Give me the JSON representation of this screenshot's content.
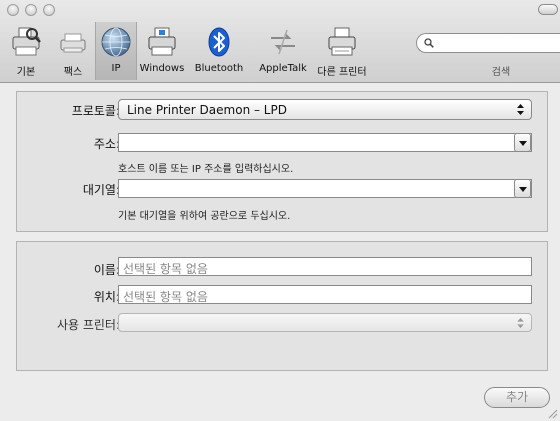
{
  "toolbar": {
    "items": [
      {
        "label": "기본",
        "icon": "default-printer-icon",
        "selected": false
      },
      {
        "label": "팩스",
        "icon": "fax-icon",
        "selected": false
      },
      {
        "label": "IP",
        "icon": "ip-globe-icon",
        "selected": true
      },
      {
        "label": "Windows",
        "icon": "windows-printer-icon",
        "selected": false
      },
      {
        "label": "Bluetooth",
        "icon": "bluetooth-icon",
        "selected": false
      },
      {
        "label": "AppleTalk",
        "icon": "appletalk-icon",
        "selected": false
      },
      {
        "label": "다른 프린터",
        "icon": "other-printer-icon",
        "selected": false
      }
    ],
    "search": {
      "label": "검색",
      "value": "",
      "icon": "magnifier-icon"
    }
  },
  "connection": {
    "protocol_label": "프로토콜:",
    "protocol_value": "Line Printer Daemon – LPD",
    "address_label": "주소:",
    "address_value": "",
    "address_hint": "호스트 이름 또는 IP 주소를 입력하십시오.",
    "queue_label": "대기열:",
    "queue_value": "",
    "queue_hint": "기본 대기열을 위하여 공란으로 두십시오."
  },
  "details": {
    "name_label": "이름:",
    "name_placeholder": "선택된 항목 없음",
    "location_label": "위치:",
    "location_placeholder": "선택된 항목 없음",
    "driver_label": "사용 프린터:",
    "driver_value": ""
  },
  "actions": {
    "add_label": "추가"
  }
}
